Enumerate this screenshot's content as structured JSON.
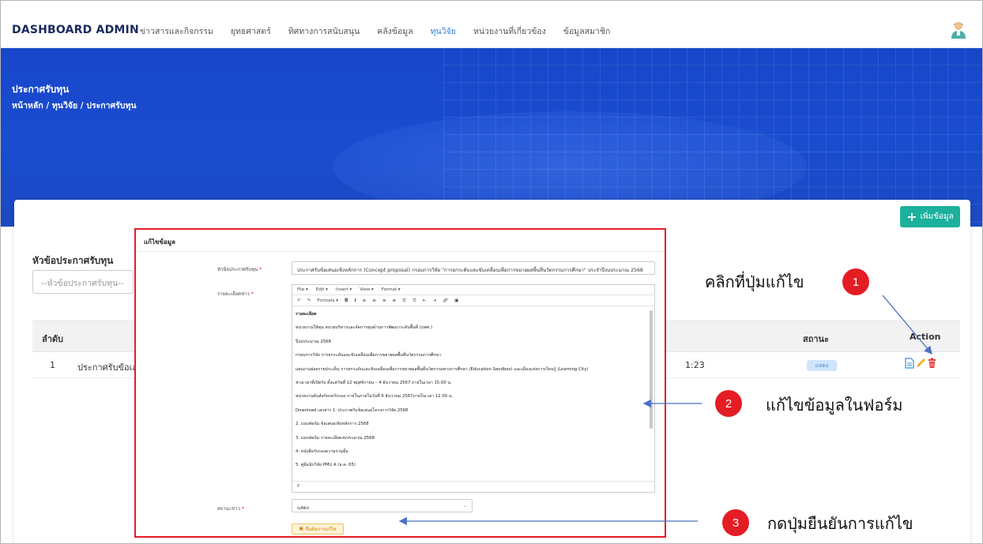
{
  "nav": {
    "brand": "DASHBOARD ADMIN",
    "items": [
      {
        "label": "ข่าวสารและกิจกรรม",
        "active": false
      },
      {
        "label": "ยุทธศาสตร์",
        "active": false
      },
      {
        "label": "ทิศทางการสนับสนุน",
        "active": false
      },
      {
        "label": "คลังข้อมูล",
        "active": false
      },
      {
        "label": "ทุนวิจัย",
        "active": true
      },
      {
        "label": "หน่วยงานที่เกี่ยวข้อง",
        "active": false
      },
      {
        "label": "ข้อมูลสมาชิก",
        "active": false
      }
    ]
  },
  "page": {
    "title": "ประกาศรับทุน",
    "breadcrumb": "หน้าหลัก / ทุนวิจัย / ประกาศรับทุน"
  },
  "list": {
    "add_button": "เพิ่มข้อมูล",
    "filter_label": "หัวข้อประกาศรับทุน",
    "filter_placeholder": "--หัวข้อประกาศรับทุน--",
    "columns": {
      "no": "ลำดับ",
      "status": "สถานะ",
      "action": "Action"
    },
    "row": {
      "no": "1",
      "title": "ประกาศรับข้อเสนอ",
      "time": "1:23",
      "status": "แสดง"
    }
  },
  "modal": {
    "title": "แก้ไขข้อมูล",
    "title_label": "หัวข้อประกาศรับทุน",
    "title_value": "ประกาศรับข้อเสนอเชิงหลักการ (Concept proposal) กรอบการวิจัย \"การยกระดับและขับเคลื่อนเพื่อการขยายผลพื้นที่นวัตกรรมการศึกษา\" ประจำปีงบประมาณ 2568",
    "detail_label": "รายละเอียดข่าว",
    "editor_menu": [
      "File",
      "Edit",
      "Insert",
      "View",
      "Format"
    ],
    "editor_formats": "Formats",
    "editor_paragraphs": [
      "รายละเอียด",
      "หน่วยงานให้ทุน หน่วยบริหารและจัดการทุนด้านการพัฒนาระดับพื้นที่ (บพท.)",
      "ปีงบประมาณ 2568",
      "กรอบการวิจัย การยกระดับและขับเคลื่อนเพื่อการขยายผลพื้นที่นวัตกรรมการศึกษา",
      "แผนงานย่อยรายประเด็น การยกระดับและขับเคลื่อนเพื่อการขยายผลพื้นที่นวัตกรรมทางการศึกษา (Education Sandbox) และเมืองแห่งการเรียนรู้ (Learning City)",
      "ช่วงเวลาที่เปิดรับ ตั้งแต่วันที่ 12 พฤศจิกายน – 4 ธันวาคม 2567 ภายในเวลา 15.00 น.",
      "หน่วยงานต้นสังกัดกดรับรอง ภายในภายในวันที่ 6 ธันวาคม 2567ภายในเวลา 12.00 น.",
      "Download เอกสาร 1. ประกาศรับข้อเสนอโครงการวิจัย 2568",
      "2. แบบฟอร์ม ข้อเสนอเชิงหลักการ 2568",
      "3. แบบฟอร์ม รายละเอียดงบประมาณ 2568",
      "4. หนังสือรับรองความร่วมมือ",
      "5. คู่มือนักวิจัย PMU A (ธ.ค. 65)"
    ],
    "editor_status": "P",
    "status_label": "สถานะข่าว",
    "status_value": "แสดง",
    "confirm_button": "ยืนยันการแก้ไข"
  },
  "callouts": [
    {
      "number": "1",
      "text": "คลิกที่ปุ่มแก้ไข"
    },
    {
      "number": "2",
      "text": "แก้ไขข้อมูลในฟอร์ม"
    },
    {
      "number": "3",
      "text": "กดปุ่มยืนยันการแก้ไข"
    }
  ],
  "colors": {
    "brand": "#1a2a5e",
    "banner": "#1a4cd0",
    "accent_red": "#e41d24",
    "add_green": "#1cb09d",
    "nav_active": "#2f80d8"
  }
}
